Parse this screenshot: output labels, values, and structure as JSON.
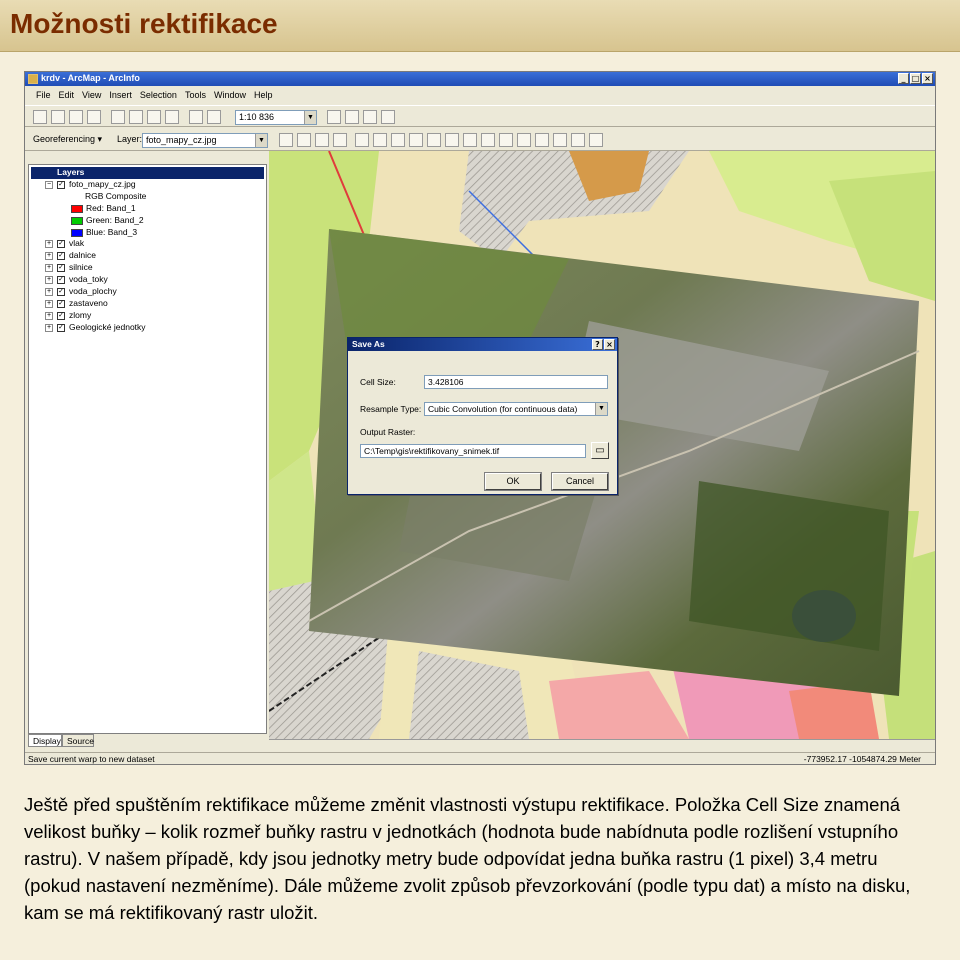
{
  "slide": {
    "title": "Možnosti rektifikace",
    "body": "Ještě před spuštěním rektifikace můžeme změnit vlastnosti výstupu rektifikace. Položka Cell Size znamená velikost buňky – kolik rozmeř buňky rastru v jednotkách (hodnota bude nabídnuta podle rozlišení vstupního rastru). V našem případě, kdy jsou jednotky metry bude odpovídat jedna buňka rastru (1 pixel) 3,4 metru (pokud nastavení nezměníme). Dále můžeme zvolit způsob převzorkování (podle typu dat) a místo na disku, kam se má rektifikovaný rastr uložit."
  },
  "window": {
    "title": "krdv - ArcMap - ArcInfo",
    "menu": [
      "File",
      "Edit",
      "View",
      "Insert",
      "Selection",
      "Tools",
      "Window",
      "Help"
    ],
    "scale": "1:10 836",
    "georef_label": "Georeferencing ▾",
    "layer_label": "Layer:",
    "layer_value": "foto_mapy_cz.jpg"
  },
  "toc": {
    "header": "Layers",
    "raster_layer": "foto_mapy_cz.jpg",
    "composite": "RGB Composite",
    "bands": [
      {
        "label": "Red:   Band_1",
        "color": "#ff0000"
      },
      {
        "label": "Green: Band_2",
        "color": "#00cc00"
      },
      {
        "label": "Blue:  Band_3",
        "color": "#0000ff"
      }
    ],
    "layers": [
      "vlak",
      "dalnice",
      "silnice",
      "voda_toky",
      "voda_plochy",
      "zastaveno",
      "zlomy",
      "Geologické jednotky"
    ],
    "tabs": [
      "Display",
      "Source"
    ]
  },
  "status": {
    "message": "Save current warp to new dataset",
    "coords": "-773952.17  -1054874.29 Meter"
  },
  "dialog": {
    "title": "Save As",
    "cell_size_label": "Cell Size:",
    "cell_size_value": "3.428106",
    "resample_label": "Resample Type:",
    "resample_value": "Cubic Convolution (for continuous data)",
    "output_label": "Output Raster:",
    "output_value": "C:\\Temp\\gis\\rektifikovany_snimek.tif",
    "ok": "OK",
    "cancel": "Cancel"
  }
}
